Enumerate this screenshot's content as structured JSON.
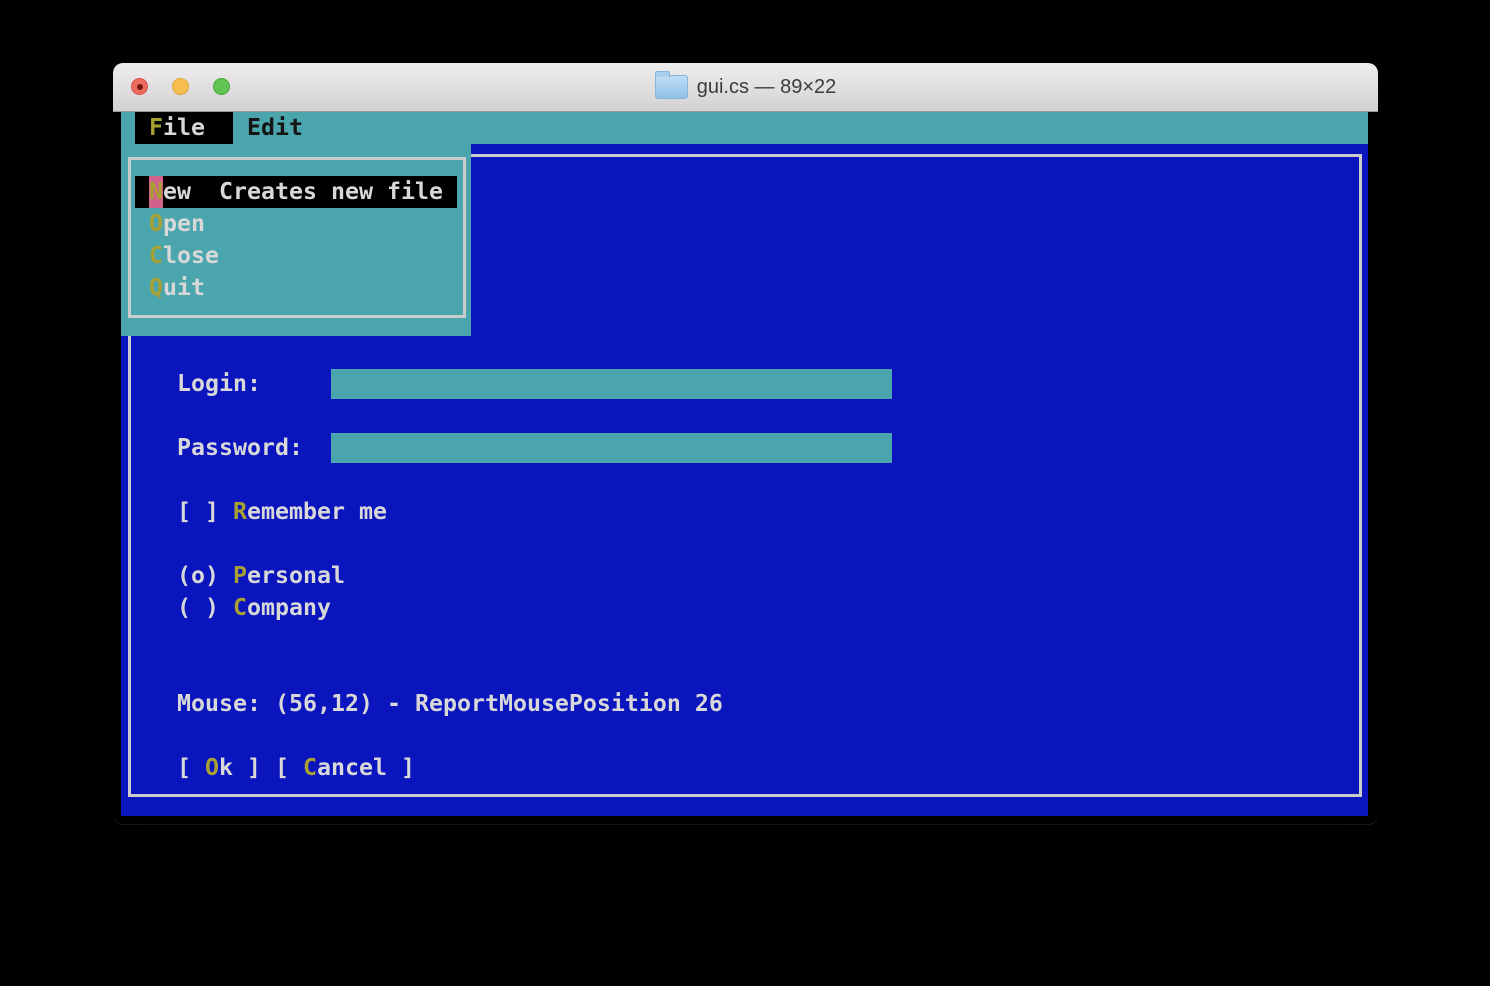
{
  "titlebar": {
    "title": "gui.cs — 89×22",
    "traffic_lights": [
      "close",
      "minimize",
      "zoom"
    ]
  },
  "menubar": {
    "file": {
      "hot": "F",
      "rest": "ile",
      "selected": true
    },
    "edit": {
      "label": "Edit",
      "selected": false
    }
  },
  "file_menu": {
    "new": {
      "hot": "N",
      "rest": "ew",
      "help": "Creates new file",
      "selected": true
    },
    "open": {
      "hot": "O",
      "rest": "pen"
    },
    "close": {
      "hot": "C",
      "rest": "lose"
    },
    "quit": {
      "hot": "Q",
      "rest": "uit"
    }
  },
  "form": {
    "login_label": "Login:",
    "login_value": "",
    "password_label": "Password:",
    "password_value": "",
    "checkbox": {
      "box": "[ ] ",
      "hot": "R",
      "rest": "emember me",
      "checked": false
    },
    "radio_personal": {
      "box": "(o) ",
      "hot": "P",
      "rest": "ersonal",
      "selected": true
    },
    "radio_company": {
      "box": "( ) ",
      "hot": "C",
      "rest": "ompany",
      "selected": false
    },
    "status": "Mouse: (56,12) - ReportMousePosition 26",
    "ok_button": {
      "pre": "[ ",
      "hot": "O",
      "rest": "k ]"
    },
    "cancel_button": {
      "pre": "[ ",
      "hot": "C",
      "rest": "ancel ]"
    }
  },
  "colors": {
    "window_blue": "#0A15BE",
    "menu_teal": "#4BA5AD",
    "hotkey_olive": "#A8A030",
    "text_gray": "#D8D8D8",
    "selected_item_bg": "#000000",
    "selected_hotkey_bg_pink": "#D2618C",
    "frame_border": "#CBCBCB"
  }
}
